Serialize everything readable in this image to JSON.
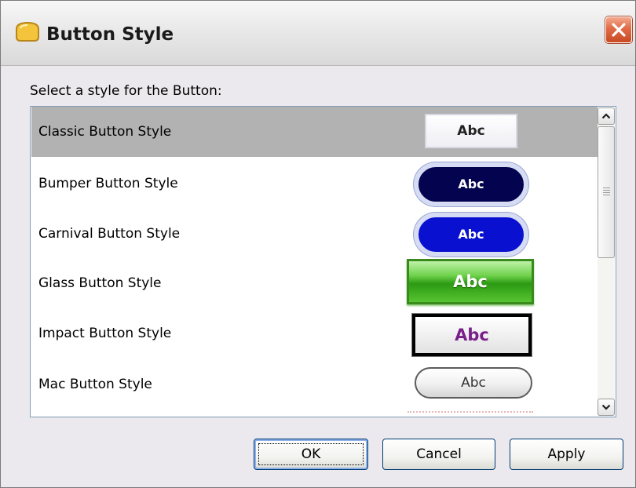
{
  "window": {
    "title": "Button Style",
    "icon": "app-icon",
    "close_icon": "close-icon"
  },
  "prompt": "Select a style for the Button:",
  "styles": [
    {
      "label": "Classic Button Style",
      "preview_text": "Abc",
      "selected": true
    },
    {
      "label": "Bumper Button Style",
      "preview_text": "Abc",
      "selected": false
    },
    {
      "label": "Carnival Button Style",
      "preview_text": "Abc",
      "selected": false
    },
    {
      "label": "Glass Button Style",
      "preview_text": "Abc",
      "selected": false
    },
    {
      "label": "Impact Button Style",
      "preview_text": "Abc",
      "selected": false
    },
    {
      "label": "Mac Button Style",
      "preview_text": "Abc",
      "selected": false
    }
  ],
  "scrollbar": {
    "up_icon": "chevron-up-icon",
    "down_icon": "chevron-down-icon",
    "grip_icon": "grip-icon"
  },
  "buttons": {
    "ok": "OK",
    "cancel": "Cancel",
    "apply": "Apply"
  },
  "colors": {
    "selected_row": "#b2b2b2",
    "close_button": "#e06a45",
    "bumper": "#03034f",
    "carnival": "#0a10cf",
    "glass": "#2c9a12",
    "impact_text": "#7a1f8a"
  }
}
